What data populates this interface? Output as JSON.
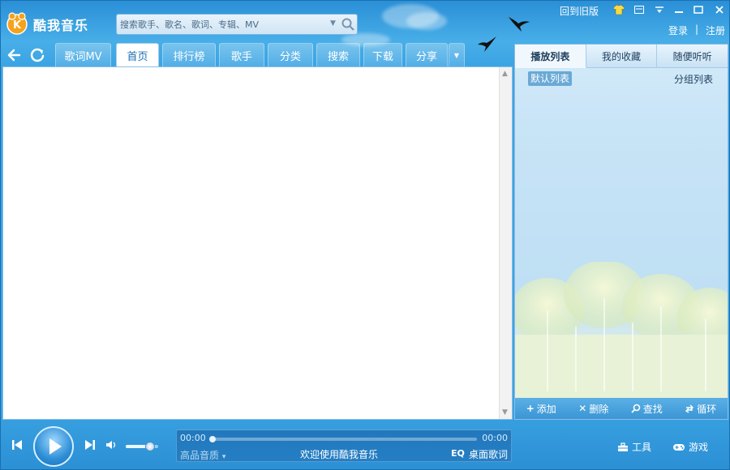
{
  "app": {
    "title": "酷我音乐",
    "logo_text": "K"
  },
  "search": {
    "placeholder": "搜索歌手、歌名、歌词、专辑、MV"
  },
  "top_bar": {
    "old_version": "回到旧版",
    "login": "登录",
    "separator": "|",
    "register": "注册"
  },
  "tabs": [
    {
      "label": "歌词MV"
    },
    {
      "label": "首页"
    },
    {
      "label": "排行榜"
    },
    {
      "label": "歌手"
    },
    {
      "label": "分类"
    },
    {
      "label": "搜索"
    },
    {
      "label": "下载"
    },
    {
      "label": "分享"
    }
  ],
  "right_panel": {
    "tabs": [
      {
        "label": "播放列表"
      },
      {
        "label": "我的收藏"
      },
      {
        "label": "随便听听"
      }
    ],
    "default_list": "默认列表",
    "group_list": "分组列表",
    "actions": [
      {
        "icon": "plus-icon",
        "label": "添加"
      },
      {
        "icon": "x-icon",
        "label": "删除"
      },
      {
        "icon": "search-icon",
        "label": "查找"
      },
      {
        "icon": "loop-icon",
        "label": "循环"
      }
    ]
  },
  "player": {
    "time_current": "00:00",
    "time_total": "00:00",
    "progress": 0,
    "quality": "高品音质",
    "quality_arrow": "▾",
    "welcome": "欢迎使用酷我音乐",
    "eq": "EQ",
    "desktop_lyrics": "桌面歌词",
    "volume": 0.75,
    "tools": "工具",
    "games": "游戏"
  },
  "colors": {
    "accent": "#1c6db5",
    "chrome": "#3aa3e3"
  }
}
